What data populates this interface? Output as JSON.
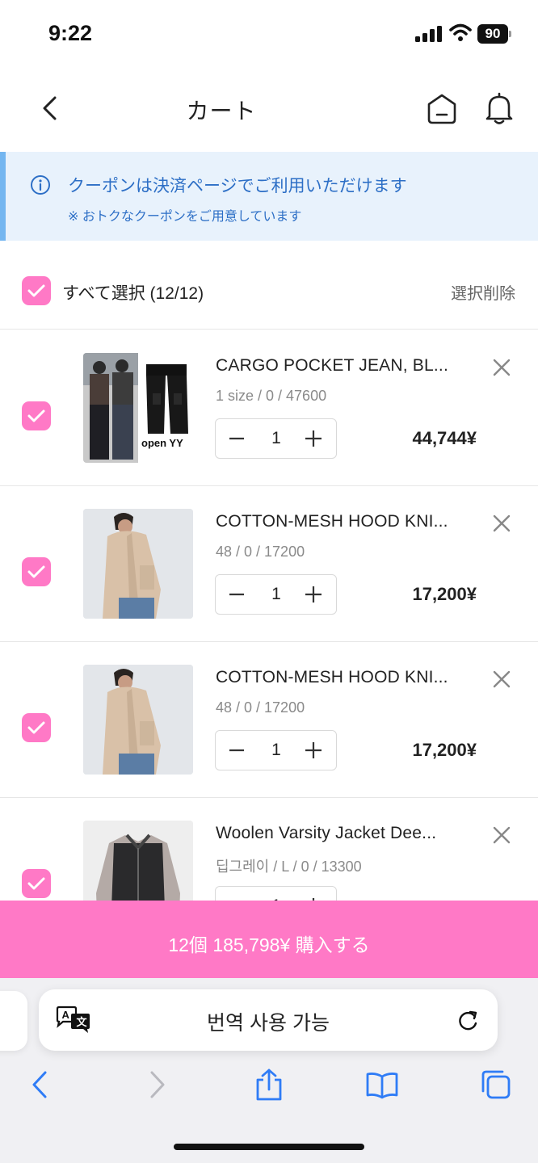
{
  "status_bar": {
    "time": "9:22",
    "battery": "90"
  },
  "header": {
    "title": "カート"
  },
  "coupon": {
    "main": "クーポンは決済ページでご利用いただけます",
    "sub": "※ おトクなクーポンをご用意しています"
  },
  "select_all": {
    "label": "すべて選択 (12/12)",
    "delete": "選択削除"
  },
  "items": [
    {
      "name": "CARGO POCKET JEAN, BL...",
      "option": "1 size / 0 / 47600",
      "qty": "1",
      "price": "44,744¥",
      "thumb_text": "open YY"
    },
    {
      "name": "COTTON-MESH HOOD KNI...",
      "option": "48 / 0 / 17200",
      "qty": "1",
      "price": "17,200¥"
    },
    {
      "name": "COTTON-MESH HOOD KNI...",
      "option": "48 / 0 / 17200",
      "qty": "1",
      "price": "17,200¥"
    },
    {
      "name": "Woolen Varsity Jacket Dee...",
      "option": "딥그레이 / L / 0 / 13300",
      "qty": "1",
      "price": ""
    }
  ],
  "purchase": {
    "label": "12個 185,798¥ 購入する"
  },
  "browser": {
    "address": "번역 사용 가능"
  },
  "colors": {
    "accent_pink": "#ff79c6",
    "banner_bg": "#e8f2fc",
    "banner_text": "#2d6fc6",
    "ios_blue": "#2f7cf6"
  }
}
